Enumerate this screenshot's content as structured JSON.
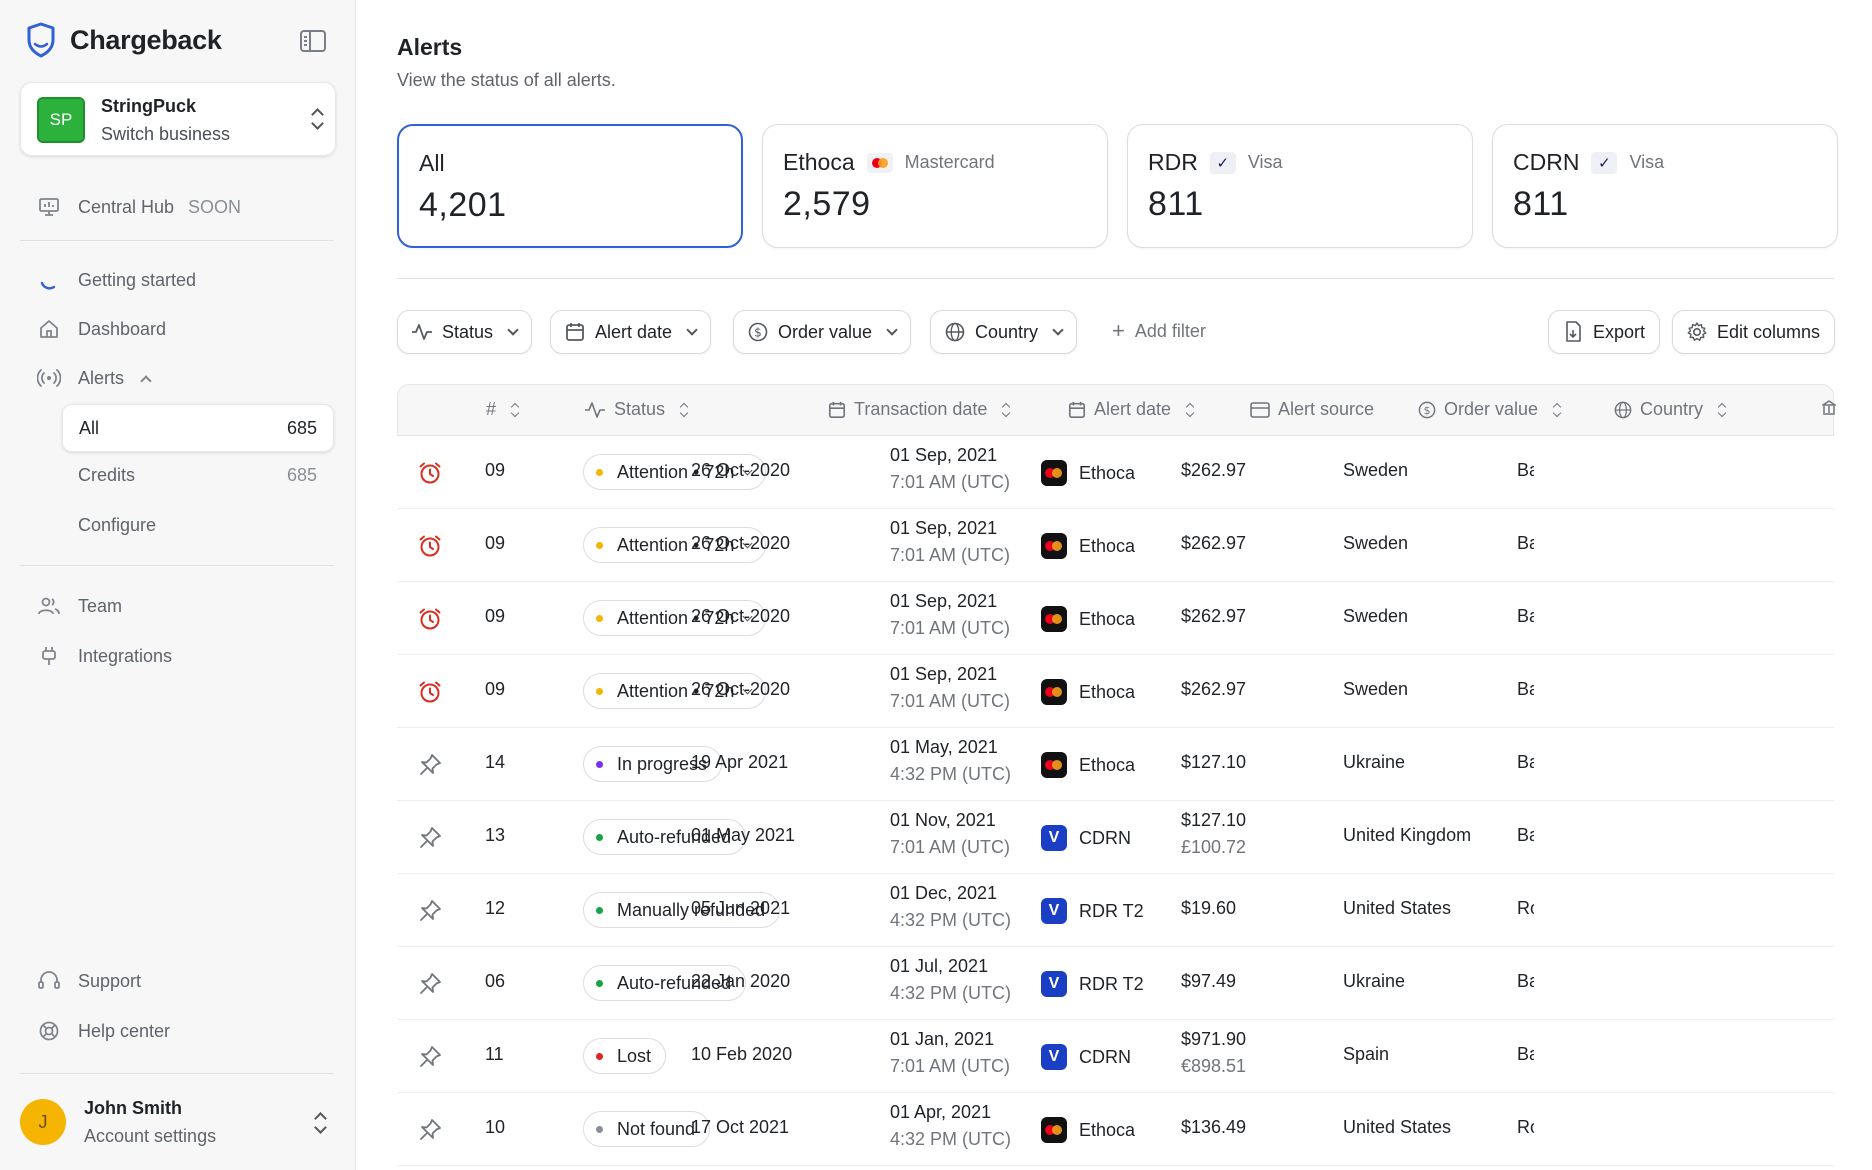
{
  "brand": {
    "name": "Chargeback"
  },
  "business": {
    "initials": "SP",
    "name": "StringPuck",
    "action": "Switch business"
  },
  "nav": {
    "central_hub": "Central Hub",
    "central_hub_badge": "SOON",
    "getting_started": "Getting started",
    "dashboard": "Dashboard",
    "alerts": "Alerts",
    "alerts_sub": [
      {
        "label": "All",
        "count": "685"
      },
      {
        "label": "Credits",
        "count": "685"
      },
      {
        "label": "Configure",
        "count": ""
      }
    ],
    "team": "Team",
    "integrations": "Integrations",
    "support": "Support",
    "help_center": "Help center"
  },
  "user": {
    "initial": "J",
    "name": "John Smith",
    "action": "Account settings"
  },
  "header": {
    "title": "Alerts",
    "subtitle": "View the status of all alerts."
  },
  "cards": [
    {
      "title": "All",
      "network": "",
      "value": "4,201"
    },
    {
      "title": "Ethoca",
      "network": "Mastercard",
      "value": "2,579"
    },
    {
      "title": "RDR",
      "network": "Visa",
      "value": "811"
    },
    {
      "title": "CDRN",
      "network": "Visa",
      "value": "811"
    }
  ],
  "filters": {
    "status": "Status",
    "alert_date": "Alert date",
    "order_value": "Order value",
    "country": "Country",
    "add_filter": "Add filter",
    "export": "Export",
    "edit_columns": "Edit columns"
  },
  "table": {
    "columns": {
      "num": "#",
      "status": "Status",
      "transaction_date": "Transaction date",
      "alert_date": "Alert date",
      "alert_source": "Alert source",
      "order_value": "Order value",
      "country": "Country"
    },
    "rows": [
      {
        "icon": "alarm",
        "num": "09",
        "status": "Attention • 72h",
        "status_color": "#f5b400",
        "has_chevron": true,
        "tx_date": "26 Oct-2020",
        "alert_date": "01 Sep, 2021",
        "alert_time": "7:01 AM (UTC)",
        "source": "Ethoca",
        "source_type": "mc",
        "value": "$262.97",
        "value2": "",
        "country": "Sweden",
        "extra": "Ba"
      },
      {
        "icon": "alarm",
        "num": "09",
        "status": "Attention • 72h",
        "status_color": "#f5b400",
        "has_chevron": true,
        "tx_date": "26 Oct-2020",
        "alert_date": "01 Sep, 2021",
        "alert_time": "7:01 AM (UTC)",
        "source": "Ethoca",
        "source_type": "mc",
        "value": "$262.97",
        "value2": "",
        "country": "Sweden",
        "extra": "Ba"
      },
      {
        "icon": "alarm",
        "num": "09",
        "status": "Attention • 72h",
        "status_color": "#f5b400",
        "has_chevron": true,
        "tx_date": "26 Oct-2020",
        "alert_date": "01 Sep, 2021",
        "alert_time": "7:01 AM (UTC)",
        "source": "Ethoca",
        "source_type": "mc",
        "value": "$262.97",
        "value2": "",
        "country": "Sweden",
        "extra": "Ba"
      },
      {
        "icon": "alarm",
        "num": "09",
        "status": "Attention • 72h",
        "status_color": "#f5b400",
        "has_chevron": true,
        "tx_date": "26 Oct-2020",
        "alert_date": "01 Sep, 2021",
        "alert_time": "7:01 AM (UTC)",
        "source": "Ethoca",
        "source_type": "mc",
        "value": "$262.97",
        "value2": "",
        "country": "Sweden",
        "extra": "Ba"
      },
      {
        "icon": "pin",
        "num": "14",
        "status": "In progress",
        "status_color": "#7b2ff2",
        "has_chevron": false,
        "tx_date": "19 Apr 2021",
        "alert_date": "01 May, 2021",
        "alert_time": "4:32 PM (UTC)",
        "source": "Ethoca",
        "source_type": "mc",
        "value": "$127.10",
        "value2": "",
        "country": "Ukraine",
        "extra": "Ba"
      },
      {
        "icon": "pin",
        "num": "13",
        "status": "Auto-refunded",
        "status_color": "#17a34a",
        "has_chevron": false,
        "tx_date": "01 May 2021",
        "alert_date": "01 Nov, 2021",
        "alert_time": "7:01 AM (UTC)",
        "source": "CDRN",
        "source_type": "visa",
        "value": "$127.10",
        "value2": "£100.72",
        "country": "United Kingdom",
        "extra": "Ba"
      },
      {
        "icon": "pin",
        "num": "12",
        "status": "Manually refunded",
        "status_color": "#17a34a",
        "has_chevron": false,
        "tx_date": "05 Jun 2021",
        "alert_date": "01 Dec, 2021",
        "alert_time": "4:32 PM (UTC)",
        "source": "RDR T2",
        "source_type": "visa",
        "value": "$19.60",
        "value2": "",
        "country": "United States",
        "extra": "Ro"
      },
      {
        "icon": "pin",
        "num": "06",
        "status": "Auto-refunded",
        "status_color": "#17a34a",
        "has_chevron": false,
        "tx_date": "22 Jan 2020",
        "alert_date": "01 Jul, 2021",
        "alert_time": "4:32 PM (UTC)",
        "source": "RDR T2",
        "source_type": "visa",
        "value": "$97.49",
        "value2": "",
        "country": "Ukraine",
        "extra": "Ba"
      },
      {
        "icon": "pin",
        "num": "11",
        "status": "Lost",
        "status_color": "#dc2626",
        "has_chevron": false,
        "tx_date": "10 Feb 2020",
        "alert_date": "01 Jan, 2021",
        "alert_time": "7:01 AM (UTC)",
        "source": "CDRN",
        "source_type": "visa",
        "value": "$971.90",
        "value2": "€898.51",
        "country": "Spain",
        "extra": "Ba"
      },
      {
        "icon": "pin",
        "num": "10",
        "status": "Not found",
        "status_color": "#8a8f97",
        "has_chevron": false,
        "tx_date": "17 Oct 2021",
        "alert_date": "01 Apr, 2021",
        "alert_time": "4:32 PM (UTC)",
        "source": "Ethoca",
        "source_type": "mc",
        "value": "$136.49",
        "value2": "",
        "country": "United States",
        "extra": "Ro"
      }
    ]
  },
  "colors": {
    "accent": "#2f62d8",
    "brand_green": "#2cb23c",
    "alarm_red": "#d92d20"
  }
}
